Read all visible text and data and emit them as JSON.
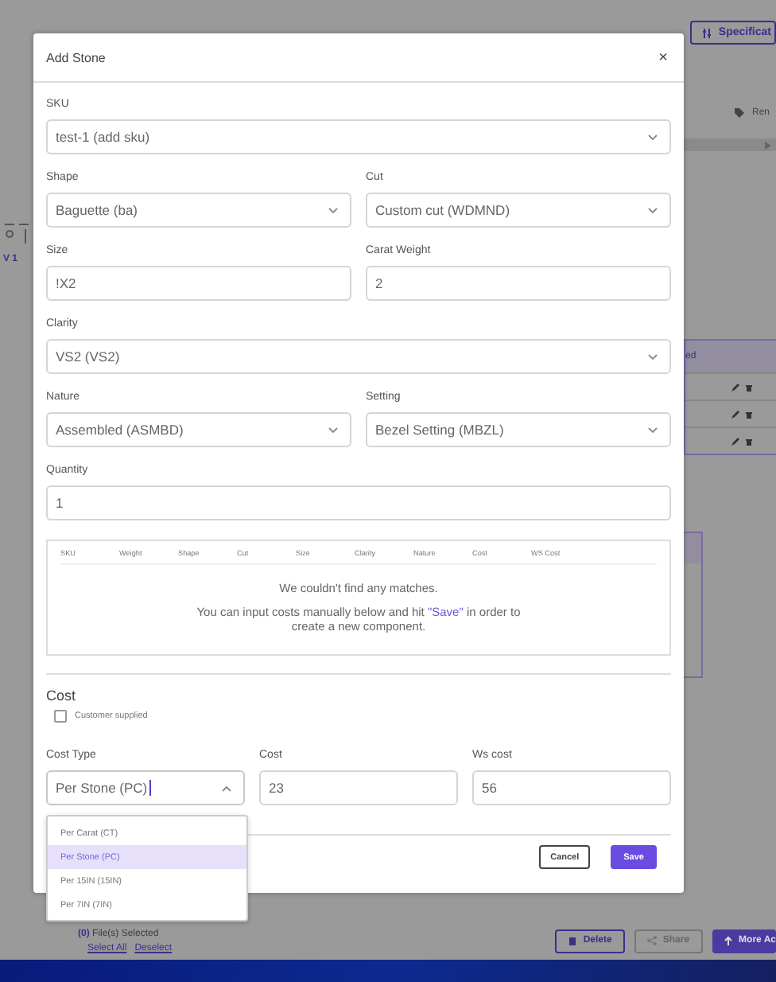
{
  "page": {
    "header_buttons": [
      {
        "kind": "purple",
        "label": "Specificat"
      }
    ],
    "toolbar_label": "Ren",
    "version_label": "V 1",
    "table_header": "ed",
    "files_count": "(0)",
    "files_label": "File(s) Selected",
    "links": [
      "Select All",
      "Deselect"
    ],
    "footer_buttons": [
      {
        "kind": "delete",
        "label": "Delete"
      },
      {
        "kind": "share",
        "label": "Share"
      },
      {
        "kind": "more",
        "label": "More Ac"
      }
    ]
  },
  "modal": {
    "title": "Add Stone",
    "close": "×",
    "rows": [
      [
        {
          "kind": "select",
          "label": "SKU",
          "value": "test-1 (add sku)"
        }
      ],
      [
        {
          "kind": "select",
          "label": "Shape",
          "value": "Baguette (ba)"
        },
        {
          "kind": "select",
          "label": "Cut",
          "value": "Custom cut (WDMND)"
        }
      ],
      [
        {
          "kind": "text",
          "label": "Size",
          "value": "!X2"
        },
        {
          "kind": "text",
          "label": "Carat Weight",
          "value": "2"
        }
      ],
      [
        {
          "kind": "select",
          "label": "Clarity",
          "value": "VS2 (VS2)"
        }
      ],
      [
        {
          "kind": "select",
          "label": "Nature",
          "value": "Assembled (ASMBD)"
        },
        {
          "kind": "select",
          "label": "Setting",
          "value": "Bezel Setting (MBZL)"
        }
      ],
      [
        {
          "kind": "text",
          "label": "Quantity",
          "value": "1"
        }
      ]
    ],
    "matches": {
      "columns": [
        "SKU",
        "Weight",
        "Shape",
        "Cut",
        "Size",
        "Clarity",
        "Nature",
        "Cost",
        "WS Cost"
      ],
      "empty_title": "We couldn't find any matches.",
      "hint_before": "You can input costs manually below and hit ",
      "hint_link": "\"Save\"",
      "hint_after": " in order to create a new component."
    },
    "cost": {
      "heading": "Cost",
      "customer_supplied": {
        "label": "Customer supplied",
        "checked": false
      },
      "cost_type": {
        "label": "Cost Type",
        "value": "Per Stone (PC)",
        "expanded": true,
        "options": [
          {
            "label": "Per Carat (CT)",
            "selected": false
          },
          {
            "label": "Per Stone (PC)",
            "selected": true
          },
          {
            "label": "Per 15IN (15IN)",
            "selected": false
          },
          {
            "label": "Per 7IN (7IN)",
            "selected": false
          }
        ]
      },
      "cost_field": {
        "label": "Cost",
        "value": "23"
      },
      "ws_cost_field": {
        "label": "Ws cost",
        "value": "56"
      }
    },
    "buttons": [
      {
        "kind": "secondary",
        "label": "Cancel"
      },
      {
        "kind": "primary",
        "label": "Save"
      }
    ]
  }
}
